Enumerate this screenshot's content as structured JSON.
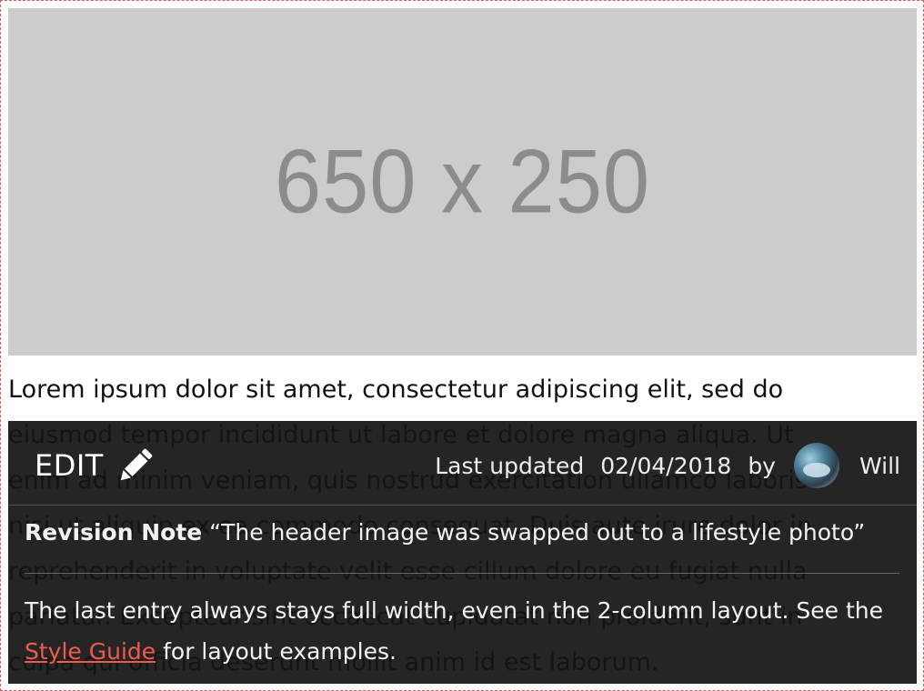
{
  "placeholder": {
    "label": "650 x 250"
  },
  "body": {
    "paragraph": "Lorem ipsum dolor sit amet, consectetur adipiscing elit, sed do\neiusmod tempor incididunt ut labore et dolore magna aliqua. Ut\nenim ad minim veniam, quis nostrud exercitation ullamco laboris\nnisi ut aliquip ex ea commodo consequat. Duis aute irure dolor in\nreprehenderit in voluptate velit esse cillum dolore eu fugiat nulla\npariatur. Excepteur sint occaecat cupidatat non proident, sunt in\nculpa qui officia deserunt mollit anim id est laborum."
  },
  "overlay": {
    "edit_label": "EDIT",
    "edit_icon": "pencil-icon",
    "last_updated_label": "Last updated",
    "date": "02/04/2018",
    "by_label": "by",
    "author": "Will",
    "revision_label": "Revision Note",
    "revision_text": "“The header image was swapped out to a lifestyle photo”",
    "note_before": "The last entry always stays full width, even in the 2-column layout. See the ",
    "note_link": "Style Guide",
    "note_after": " for layout examples."
  },
  "colors": {
    "frame_border": "#e05a5a",
    "placeholder_bg": "#cccccc",
    "overlay_bg": "#141414",
    "link": "#ee5a4e"
  }
}
